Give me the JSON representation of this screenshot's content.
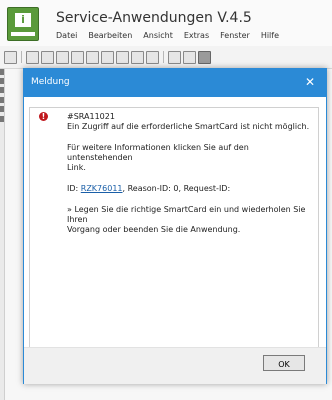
{
  "app": {
    "title": "Service-Anwendungen V.4.5",
    "logo_glyph": "i",
    "menu": [
      "Datei",
      "Bearbeiten",
      "Ansicht",
      "Extras",
      "Fenster",
      "Hilfe"
    ],
    "toolbar_icons": [
      "print-icon",
      "cut-icon",
      "copy-icon",
      "paste-icon",
      "hierarchy-icon",
      "tree-icon",
      "grid-icon",
      "list-icon",
      "gear-icon",
      "refresh-icon",
      "folder-icon",
      "pages-icon",
      "disk-icon"
    ]
  },
  "dialog": {
    "title": "Meldung",
    "close_glyph": "✕",
    "icon_glyph": "!",
    "code": "#SRA11021",
    "line1": "Ein Zugriff auf die erforderliche SmartCard ist nicht möglich.",
    "line2a": "Für weitere Informationen klicken Sie auf den untenstehenden",
    "line2b": "Link.",
    "id_prefix": "ID: ",
    "id_link": "RZK76011",
    "id_suffix": ", Reason-ID: 0, Request-ID:",
    "line4a": "» Legen Sie die richtige SmartCard ein und wiederholen Sie Ihren",
    "line4b": "Vorgang oder beenden Sie die Anwendung.",
    "ok_label": "OK"
  },
  "colors": {
    "titlebar": "#2b8ad6",
    "error_icon": "#c0181e",
    "logo": "#5a9a3a"
  }
}
